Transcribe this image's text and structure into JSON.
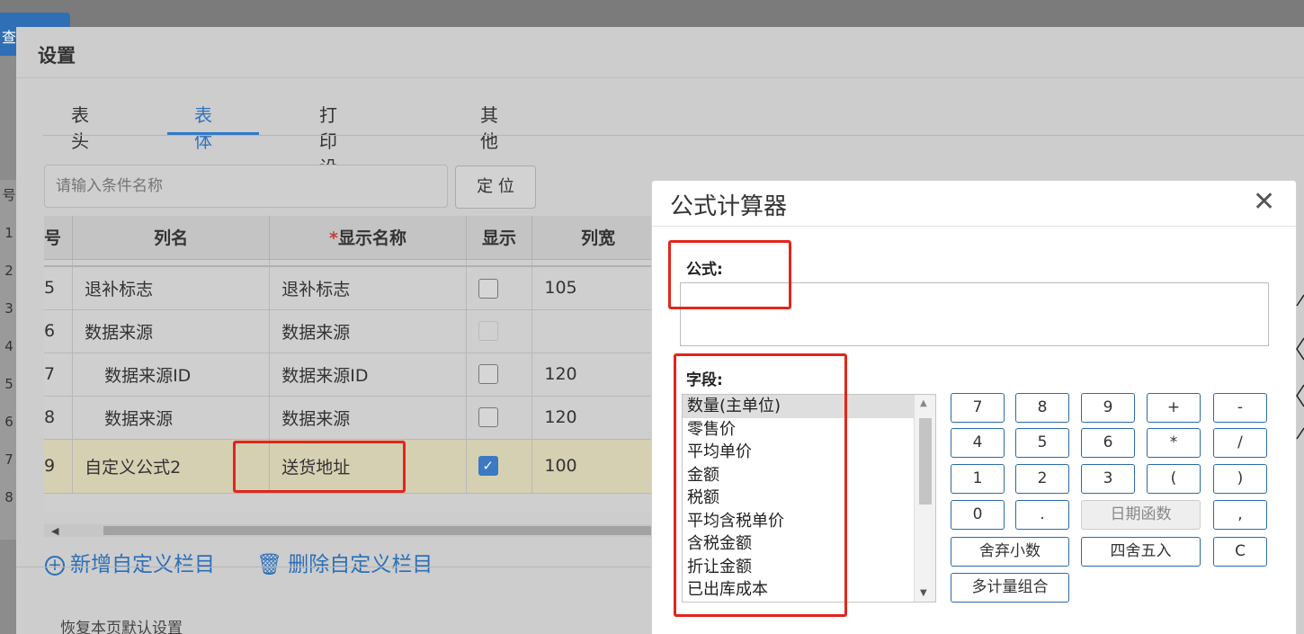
{
  "background": {
    "query_button": "查询",
    "row_numbers": [
      "号",
      "1",
      "2",
      "3",
      "4",
      "5",
      "6",
      "7",
      "8"
    ]
  },
  "dialog": {
    "title": "设置",
    "tabs": [
      "表头",
      "表体",
      "打印设置",
      "其他"
    ],
    "active_tab": "表体",
    "search_placeholder": "请输入条件名称",
    "locate_button": "定 位",
    "table": {
      "headers": [
        "号",
        "列名",
        "显示名称",
        "显示",
        "列宽"
      ],
      "required_mark": "*",
      "rows": [
        {
          "no": "5",
          "name": "退补标志",
          "display": "退补标志",
          "show": "unchecked",
          "width": "105"
        },
        {
          "no": "6",
          "name": "数据来源",
          "display": "数据来源",
          "show": "disabled",
          "width": ""
        },
        {
          "no": "7",
          "name": "数据来源ID",
          "display": "数据来源ID",
          "show": "unchecked",
          "width": "120"
        },
        {
          "no": "8",
          "name": "数据来源",
          "display": "数据来源",
          "show": "unchecked",
          "width": "120"
        },
        {
          "no": "9",
          "name": "自定义公式2",
          "display": "送货地址",
          "show": "checked",
          "width": "100"
        }
      ]
    },
    "add_custom": "新增自定义栏目",
    "delete_custom": "删除自定义栏目",
    "restore_default": "恢复本页默认设置"
  },
  "calculator": {
    "title": "公式计算器",
    "close_icon": "close-icon",
    "formula_label": "公式:",
    "formula_value": "",
    "field_label": "字段:",
    "fields": [
      "数量(主单位)",
      "零售价",
      "平均单价",
      "金额",
      "税额",
      "平均含税单价",
      "含税金额",
      "折让金额",
      "已出库成本"
    ],
    "selected_field": "数量(主单位)",
    "keys": {
      "k7": "7",
      "k8": "8",
      "k9": "9",
      "plus": "+",
      "minus": "-",
      "k4": "4",
      "k5": "5",
      "k6": "6",
      "mul": "*",
      "div": "/",
      "k1": "1",
      "k2": "2",
      "k3": "3",
      "lparen": "(",
      "rparen": ")",
      "k0": "0",
      "dot": ".",
      "date_func": "日期函数",
      "comma": ",",
      "truncate": "舍弃小数",
      "round": "四舍五入",
      "clear": "C",
      "multi_unit": "多计量组合"
    }
  },
  "colors": {
    "accent": "#3179c9",
    "highlight_box": "#e3251b",
    "selected_row": "#d6d0b3"
  }
}
